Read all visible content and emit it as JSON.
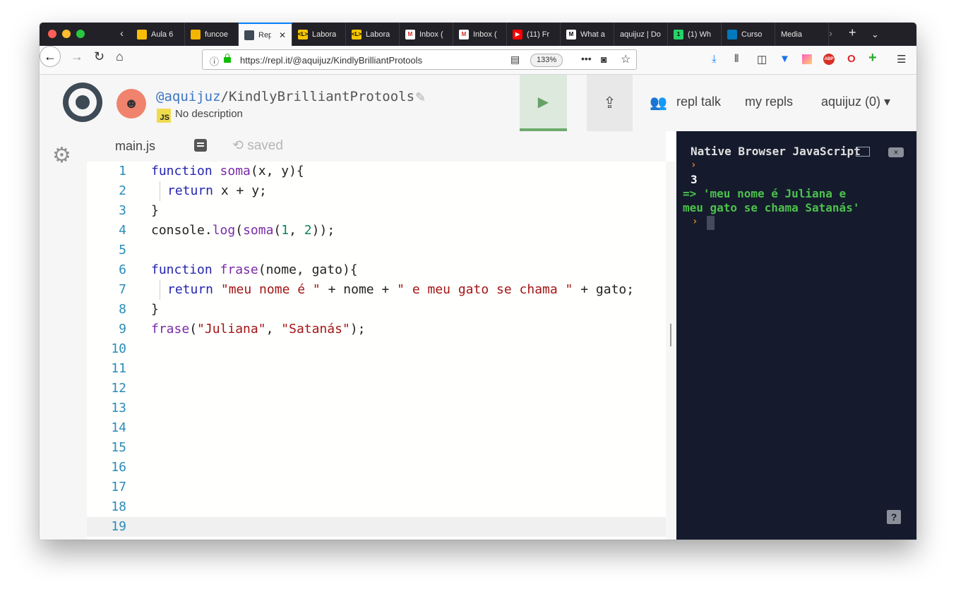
{
  "tabs": [
    {
      "label": "Aula 6",
      "fav_color": "#fbbc05",
      "fav_text": "",
      "active": false
    },
    {
      "label": "funcoe",
      "fav_color": "#f4b400",
      "fav_text": "",
      "active": false
    },
    {
      "label": "Repl",
      "fav_color": "#3e4a55",
      "fav_text": "",
      "active": true
    },
    {
      "label": "Labora",
      "fav_color": "#f7c600",
      "fav_text": "<L>",
      "active": false
    },
    {
      "label": "Labora",
      "fav_color": "#f7c600",
      "fav_text": "<L>",
      "active": false
    },
    {
      "label": "Inbox (",
      "fav_color": "#d93025",
      "fav_text": "M",
      "active": false
    },
    {
      "label": "Inbox (",
      "fav_color": "#d93025",
      "fav_text": "M",
      "active": false
    },
    {
      "label": "(11) Fr",
      "fav_color": "#ff0000",
      "fav_text": "▶",
      "active": false
    },
    {
      "label": "What a",
      "fav_color": "#ffffff",
      "fav_text": "M",
      "active": false
    },
    {
      "label": "aquijuz | Do",
      "fav_color": "",
      "fav_text": "",
      "active": false
    },
    {
      "label": "(1) Wh",
      "fav_color": "#25d366",
      "fav_text": "1",
      "active": false
    },
    {
      "label": "Curso",
      "fav_color": "#0079bf",
      "fav_text": "",
      "active": false
    },
    {
      "label": "Media",
      "fav_color": "",
      "fav_text": "",
      "active": false
    }
  ],
  "nav": {
    "url": "https://repl.it/@aquijuz/KindlyBrilliantProtools",
    "zoom": "133%"
  },
  "header": {
    "user": "@aquijuz",
    "repl_name": "/KindlyBrilliantProtools",
    "lang_badge": "JS",
    "description": "No description",
    "repl_talk": "repl talk",
    "my_repls": "my repls",
    "account": "aquijuz (0) ▾"
  },
  "editor": {
    "file_tab": "main.js",
    "save_status": "saved",
    "lines": [
      {
        "n": "1"
      },
      {
        "n": "2"
      },
      {
        "n": "3"
      },
      {
        "n": "4"
      },
      {
        "n": "5"
      },
      {
        "n": "6"
      },
      {
        "n": "7"
      },
      {
        "n": "8"
      },
      {
        "n": "9"
      },
      {
        "n": "10"
      },
      {
        "n": "11"
      },
      {
        "n": "12"
      },
      {
        "n": "13"
      },
      {
        "n": "14"
      },
      {
        "n": "15"
      },
      {
        "n": "16"
      },
      {
        "n": "17"
      },
      {
        "n": "18"
      },
      {
        "n": "19"
      }
    ],
    "code": {
      "l1_kw": "function",
      "l1_fn": "soma",
      "l1_rest": "(x, y){",
      "l2_kw": "return",
      "l2_rest": " x + y;",
      "l3": "}",
      "l4_a": "console.",
      "l4_fn1": "log",
      "l4_b": "(",
      "l4_fn2": "soma",
      "l4_c": "(",
      "l4_n1": "1",
      "l4_d": ", ",
      "l4_n2": "2",
      "l4_e": "));",
      "l6_kw": "function",
      "l6_fn": "frase",
      "l6_rest": "(nome, gato){",
      "l7_kw": "return",
      "l7_s1": "\"meu nome é \"",
      "l7_m1": " + nome + ",
      "l7_s2": "\" e meu gato se chama \"",
      "l7_m2": " + gato;",
      "l8": "}",
      "l9_fn": "frase",
      "l9_a": "(",
      "l9_s1": "\"Juliana\"",
      "l9_b": ", ",
      "l9_s2": "\"Satanás\"",
      "l9_c": ");"
    }
  },
  "console": {
    "title": "Native Browser JavaScript",
    "output": "3",
    "result": "=> 'meu nome é Juliana e\nmeu gato se chama Satanás'",
    "help": "?"
  }
}
